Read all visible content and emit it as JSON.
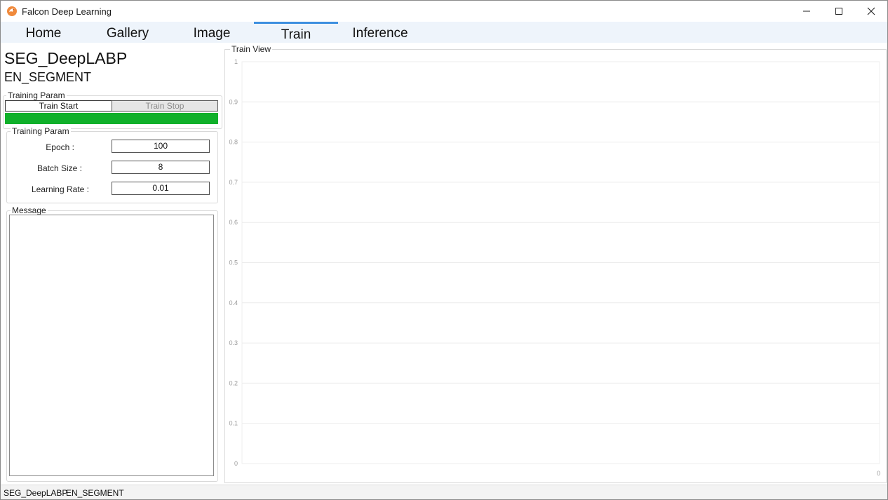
{
  "window": {
    "title": "Falcon Deep Learning",
    "icon": "falcon-logo-icon",
    "accent_color": "#3d8fe0"
  },
  "tabs": [
    {
      "label": "Home",
      "active": false
    },
    {
      "label": "Gallery",
      "active": false
    },
    {
      "label": "Image",
      "active": false
    },
    {
      "label": "Train",
      "active": true
    },
    {
      "label": "Inference",
      "active": false
    }
  ],
  "model": {
    "name": "SEG_DeepLABP",
    "type": "EN_SEGMENT"
  },
  "training_control": {
    "legend": "Training Param",
    "start_label": "Train Start",
    "stop_label": "Train Stop",
    "progress": 1.0,
    "progress_color": "#10b02a"
  },
  "training_params": {
    "legend": "Training Param",
    "epoch_label": "Epoch :",
    "epoch_value": "100",
    "batch_label": "Batch Size :",
    "batch_value": "8",
    "lr_label": "Learning Rate :",
    "lr_value": "0.01"
  },
  "message": {
    "legend": "Message",
    "text": ""
  },
  "train_view": {
    "legend": "Train View"
  },
  "chart_data": {
    "type": "line",
    "title": "",
    "xlabel": "",
    "ylabel": "",
    "series": [],
    "y_ticks": [
      "1",
      "0.9",
      "0.8",
      "0.7",
      "0.6",
      "0.5",
      "0.4",
      "0.3",
      "0.2",
      "0.1",
      "0"
    ],
    "x_ticks": [
      "0"
    ],
    "ylim": [
      0,
      1
    ],
    "grid": true
  },
  "status": {
    "model_name": "SEG_DeepLABP",
    "model_type": "EN_SEGMENT"
  }
}
